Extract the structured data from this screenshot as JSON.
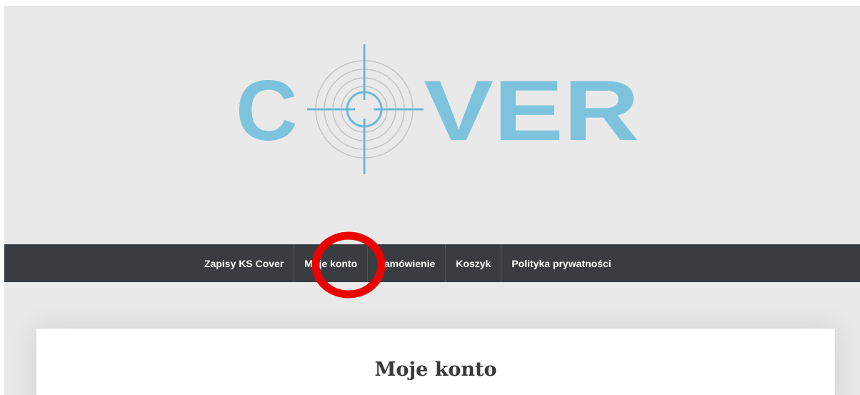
{
  "logo": {
    "text": "COVER",
    "brand_color": "#7ec3dd",
    "crosshair_color": "#6fb8d8",
    "ring_color": "#c4c4c4"
  },
  "nav": {
    "items": [
      {
        "label": "Zapisy KS Cover"
      },
      {
        "label": "Moje konto"
      },
      {
        "label": "Zamówienie"
      },
      {
        "label": "Koszyk"
      },
      {
        "label": "Polityka prywatności"
      }
    ],
    "background": "#393d41"
  },
  "annotation": {
    "color": "#ee0000",
    "target": "Moje konto"
  },
  "main": {
    "page_title": "Moje konto"
  }
}
